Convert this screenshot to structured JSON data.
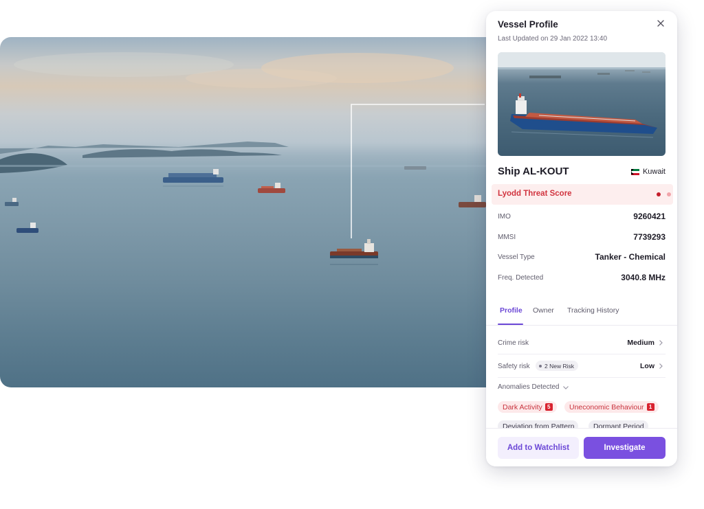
{
  "panel": {
    "title": "Vessel Profile",
    "last_updated": "Last Updated on 29 Jan 2022 13:40",
    "close_icon": "close-icon"
  },
  "vessel": {
    "name": "Ship AL-KOUT",
    "country": "Kuwait",
    "flag_icon": "kuwait-flag-icon"
  },
  "threat": {
    "label": "Lyodd Threat Score",
    "color": "#d1343f"
  },
  "info": [
    {
      "label": "IMO",
      "value": "9260421"
    },
    {
      "label": "MMSI",
      "value": "7739293"
    },
    {
      "label": "Vessel Type",
      "value": "Tanker - Chemical"
    },
    {
      "label": "Freq. Detected",
      "value": "3040.8 MHz"
    }
  ],
  "tabs": [
    {
      "label": "Profile",
      "active": true
    },
    {
      "label": "Owner",
      "active": false
    },
    {
      "label": "Tracking History",
      "active": false
    }
  ],
  "risks": [
    {
      "label": "Crime risk",
      "value": "Medium",
      "badge": ""
    },
    {
      "label": "Safety risk",
      "value": "Low",
      "badge": "2 New Risk"
    }
  ],
  "anomalies": {
    "label": "Anomalies Detected",
    "chips": [
      {
        "label": "Dark Activity",
        "count": "5",
        "style": "red"
      },
      {
        "label": "Uneconomic Behaviour",
        "count": "1",
        "style": "red"
      },
      {
        "label": "Deviation from Pattern",
        "count": "",
        "style": "gray"
      },
      {
        "label": "Dormant Period",
        "count": "",
        "style": "gray"
      }
    ]
  },
  "actions": {
    "watchlist": "Add to Watchlist",
    "investigate": "Investigate"
  },
  "colors": {
    "accent": "#7a50e0",
    "threat_bg": "#fdeeee",
    "danger": "#d8222f"
  }
}
